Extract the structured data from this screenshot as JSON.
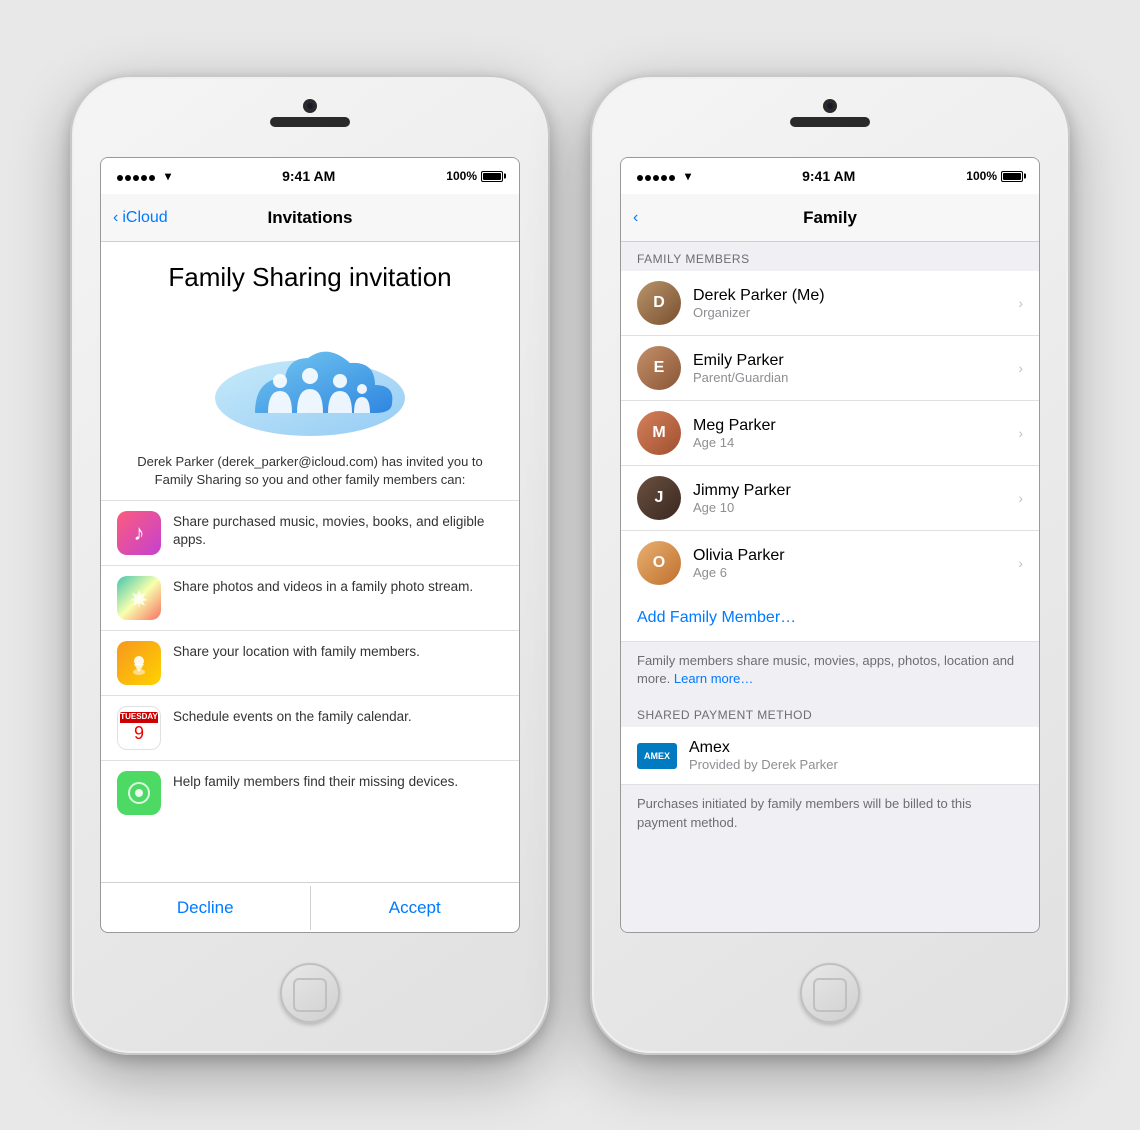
{
  "phone1": {
    "statusBar": {
      "time": "9:41 AM",
      "signal": "100%"
    },
    "navBar": {
      "backLabel": "iCloud",
      "title": "Invitations"
    },
    "invitation": {
      "title": "Family Sharing invitation",
      "description": "Derek Parker (derek_parker@icloud.com) has invited you to Family Sharing so you and other family members can:",
      "features": [
        {
          "icon": "music",
          "text": "Share purchased music, movies, books, and eligible apps."
        },
        {
          "icon": "photos",
          "text": "Share photos and videos in a family photo stream."
        },
        {
          "icon": "location",
          "text": "Share your location with family members."
        },
        {
          "icon": "calendar",
          "text": "Schedule events on the family calendar.",
          "calendarDay": "9",
          "calendarWeekday": "Tuesday"
        },
        {
          "icon": "findmy",
          "text": "Help family members find their missing devices."
        }
      ],
      "declineLabel": "Decline",
      "acceptLabel": "Accept"
    }
  },
  "phone2": {
    "statusBar": {
      "time": "9:41 AM",
      "signal": "100%"
    },
    "navBar": {
      "title": "Family"
    },
    "familyMembersHeader": "FAMILY MEMBERS",
    "members": [
      {
        "name": "Derek Parker (Me)",
        "role": "Organizer",
        "avatarClass": "av-derek",
        "initials": "D"
      },
      {
        "name": "Emily Parker",
        "role": "Parent/Guardian",
        "avatarClass": "av-emily",
        "initials": "E"
      },
      {
        "name": "Meg Parker",
        "role": "Age 14",
        "avatarClass": "av-meg",
        "initials": "M"
      },
      {
        "name": "Jimmy Parker",
        "role": "Age 10",
        "avatarClass": "av-jimmy",
        "initials": "J"
      },
      {
        "name": "Olivia Parker",
        "role": "Age 6",
        "avatarClass": "av-olivia",
        "initials": "O"
      }
    ],
    "addMemberLabel": "Add Family Member…",
    "infoText": "Family members share music, movies, apps, photos, location and more.",
    "learnMoreLabel": "Learn more…",
    "sharedPaymentHeader": "SHARED PAYMENT METHOD",
    "payment": {
      "name": "Amex",
      "provider": "Provided by Derek Parker"
    },
    "paymentFooter": "Purchases initiated by family members will be billed to this payment method."
  }
}
